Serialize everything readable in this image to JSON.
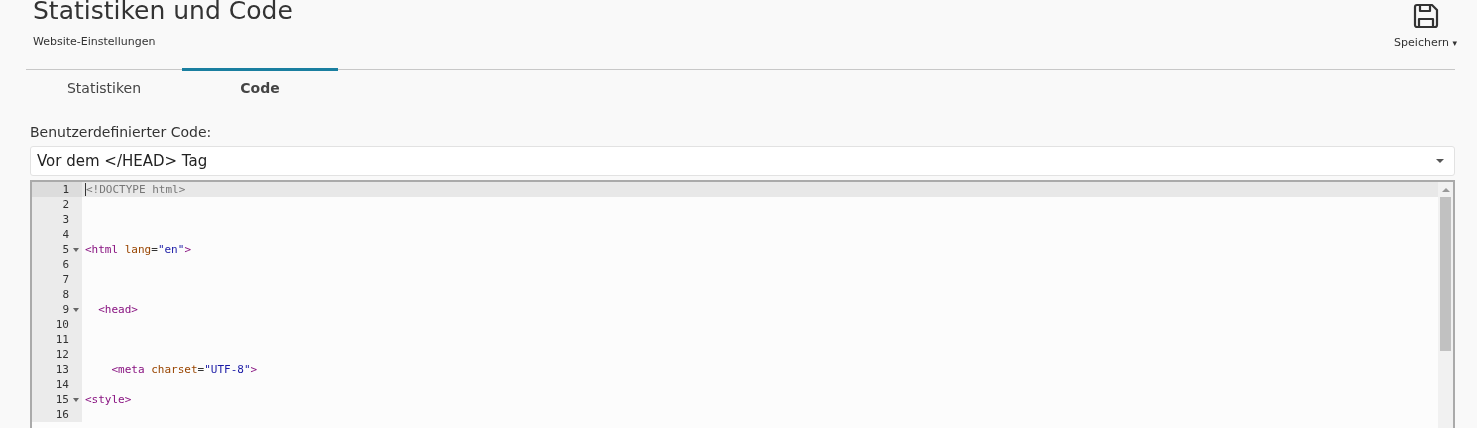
{
  "header": {
    "title": "Statistiken und Code",
    "subtitle": "Website-Einstellungen",
    "save_button": {
      "label": "Speichern",
      "caret": "▾"
    }
  },
  "tabs": [
    {
      "label": "Statistiken",
      "selected": false
    },
    {
      "label": "Code",
      "selected": true
    }
  ],
  "custom_code": {
    "label": "Benutzerdefinierter Code:",
    "select": {
      "value": "Vor dem </HEAD> Tag"
    }
  },
  "editor": {
    "lines": [
      {
        "number": "1",
        "foldable": false,
        "active": true,
        "tokens": [
          {
            "kind": "doctype",
            "text": "<!DOCTYPE html>"
          }
        ]
      },
      {
        "number": "2",
        "foldable": false,
        "active": false
      },
      {
        "number": "3",
        "foldable": false,
        "active": false
      },
      {
        "number": "4",
        "foldable": false,
        "active": false
      },
      {
        "number": "5",
        "foldable": true,
        "active": false,
        "tokens": [
          {
            "kind": "tag",
            "text": "<html"
          },
          {
            "kind": "attr",
            "text": " lang"
          },
          {
            "kind": "plain",
            "text": "="
          },
          {
            "kind": "string",
            "text": "\"en\""
          },
          {
            "kind": "tag",
            "text": ">"
          }
        ]
      },
      {
        "number": "6",
        "foldable": false,
        "active": false
      },
      {
        "number": "7",
        "foldable": false,
        "active": false
      },
      {
        "number": "8",
        "foldable": false,
        "active": false
      },
      {
        "number": "9",
        "foldable": true,
        "active": false,
        "tokens": [
          {
            "kind": "tag",
            "text": "  <head>"
          }
        ]
      },
      {
        "number": "10",
        "foldable": false,
        "active": false
      },
      {
        "number": "11",
        "foldable": false,
        "active": false
      },
      {
        "number": "12",
        "foldable": false,
        "active": false
      },
      {
        "number": "13",
        "foldable": false,
        "active": false,
        "tokens": [
          {
            "kind": "tag",
            "text": "    <meta"
          },
          {
            "kind": "attr",
            "text": " charset"
          },
          {
            "kind": "plain",
            "text": "="
          },
          {
            "kind": "string",
            "text": "\"UTF-8\""
          },
          {
            "kind": "tag",
            "text": ">"
          }
        ]
      },
      {
        "number": "14",
        "foldable": false,
        "active": false
      },
      {
        "number": "15",
        "foldable": true,
        "active": false,
        "tokens": [
          {
            "kind": "tag",
            "text": "<style>"
          }
        ]
      },
      {
        "number": "16",
        "foldable": false,
        "active": false
      }
    ]
  }
}
